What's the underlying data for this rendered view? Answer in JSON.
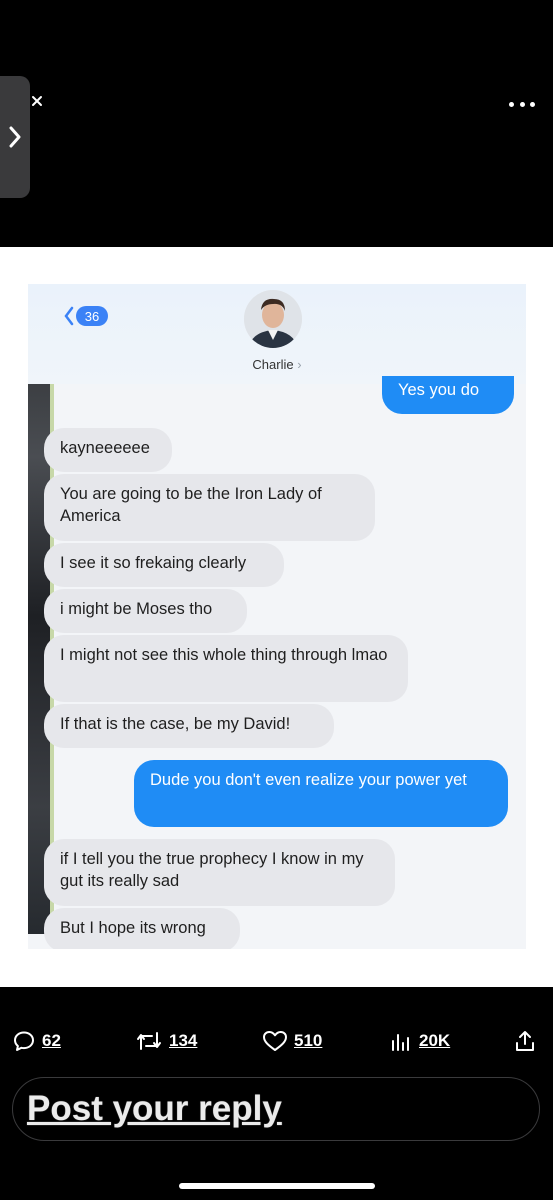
{
  "header": {
    "back_icon": "close-x-icon",
    "more_icon": "more-dots-icon",
    "side_tab_icon": "chevron-right-icon"
  },
  "chat": {
    "unread_count": "36",
    "contact_name": "Charlie",
    "messages": [
      {
        "from": "me",
        "text": "Yes you do"
      },
      {
        "from": "them",
        "text": "kayneeeeee"
      },
      {
        "from": "them",
        "text": "You are going to be the Iron Lady of America"
      },
      {
        "from": "them",
        "text": "I see it so frekaing clearly"
      },
      {
        "from": "them",
        "text": "i might be Moses tho"
      },
      {
        "from": "them",
        "text": "I might not see this whole thing through lmao"
      },
      {
        "from": "them",
        "text": "If that is the case, be my David!"
      },
      {
        "from": "me",
        "text": "Dude you don't even realize your power yet"
      },
      {
        "from": "them",
        "text": "if I tell you the true prophecy I know in my gut its really sad"
      },
      {
        "from": "them",
        "text": "But I hope its wrong"
      }
    ]
  },
  "actions": {
    "replies": "62",
    "reposts": "134",
    "likes": "510",
    "views": "20K"
  },
  "reply": {
    "placeholder": "Post your reply"
  },
  "colors": {
    "outgoing_bubble": "#1f8cf5",
    "incoming_bubble": "#e6e7eb",
    "badge": "#3b82f6"
  }
}
